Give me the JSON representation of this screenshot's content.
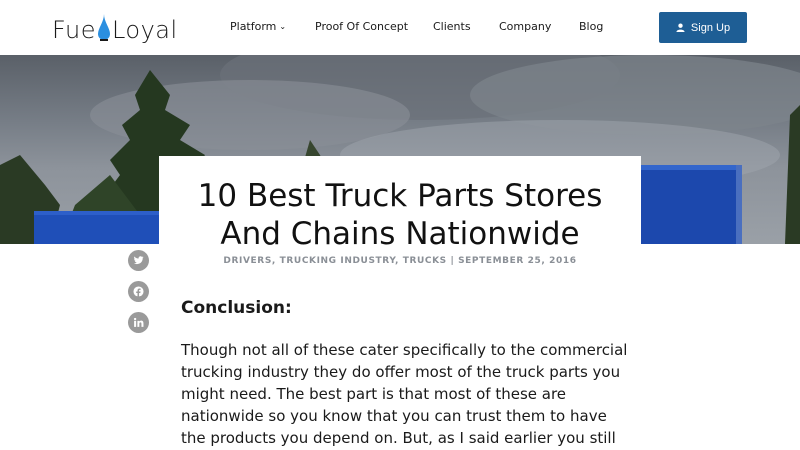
{
  "header": {
    "logo_text_left": "Fue",
    "logo_text_right": "Loyal",
    "nav": [
      {
        "label": "Platform"
      },
      {
        "label": "Proof Of Concept"
      },
      {
        "label": "Clients"
      },
      {
        "label": "Company"
      },
      {
        "label": "Blog"
      }
    ],
    "signup_label": "Sign Up"
  },
  "colors": {
    "brand_blue": "#1e5e95",
    "logo_drop": "#2b8fe0",
    "social_grey": "#9a9a9a",
    "meta_grey": "#8a8f96"
  },
  "article": {
    "title_line1": "10 Best Truck Parts Stores",
    "title_line2": "And Chains Nationwide",
    "meta": "DRIVERS, TRUCKING INDUSTRY, TRUCKS | SEPTEMBER 25, 2016",
    "heading": "Conclusion:",
    "body": "Though not all of these cater specifically to the commercial trucking industry they do offer most of the truck parts you might need. The best part is that most of these are nationwide so you know that you can trust them to have the products you depend on. But, as I said earlier you still might choose to go to"
  },
  "social": [
    {
      "icon": "twitter-icon"
    },
    {
      "icon": "facebook-icon"
    },
    {
      "icon": "linkedin-icon"
    }
  ]
}
